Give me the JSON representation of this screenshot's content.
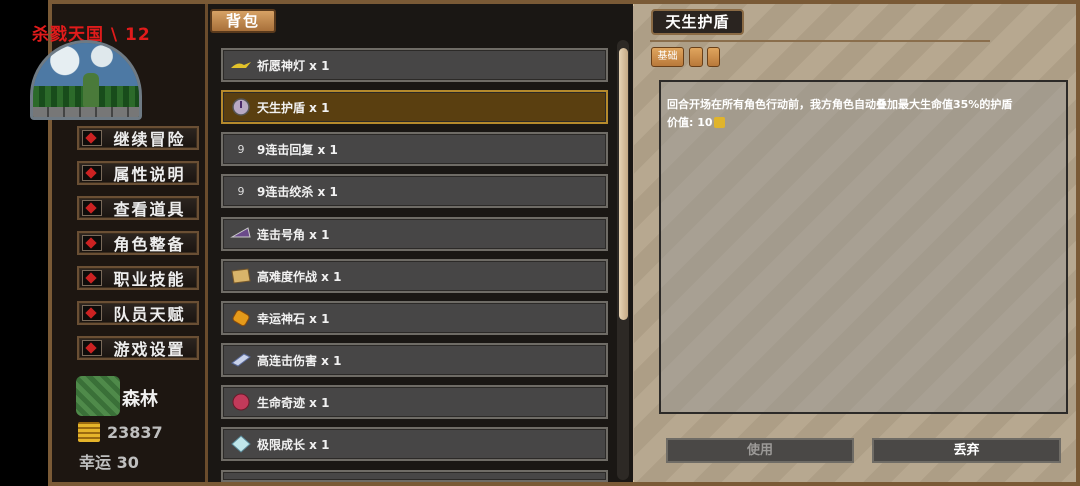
{
  "sidebar": {
    "game_title": "杀戮天国 \\ 12",
    "menu": [
      {
        "label": "继续冒险"
      },
      {
        "label": "属性说明"
      },
      {
        "label": "查看道具"
      },
      {
        "label": "角色整备"
      },
      {
        "label": "职业技能"
      },
      {
        "label": "队员天赋"
      },
      {
        "label": "游戏设置"
      }
    ],
    "region": "森林",
    "gold": "23837",
    "luck": "幸运 30"
  },
  "inventory": {
    "tab_label": "背包",
    "items": [
      {
        "name": "祈愿神灯 x 1",
        "icon": "lamp-icon",
        "selected": false
      },
      {
        "name": "天生护盾 x 1",
        "icon": "shield-orb-icon",
        "selected": true
      },
      {
        "name": "9连击回复 x 1",
        "icon_text": "9",
        "selected": false
      },
      {
        "name": "9连击绞杀 x 1",
        "icon_text": "9",
        "selected": false
      },
      {
        "name": "连击号角 x 1",
        "icon": "horn-icon",
        "selected": false
      },
      {
        "name": "高难度作战 x 1",
        "icon": "scroll-map-icon",
        "selected": false
      },
      {
        "name": "幸运神石 x 1",
        "icon": "lucky-stone-icon",
        "selected": false
      },
      {
        "name": "高连击伤害 x 1",
        "icon": "crystal-shard-icon",
        "selected": false
      },
      {
        "name": "生命奇迹 x 1",
        "icon": "life-orb-icon",
        "selected": false
      },
      {
        "name": "极限成长 x 1",
        "icon": "diamond-icon",
        "selected": false
      }
    ]
  },
  "detail": {
    "title": "天生护盾",
    "tag": "基础",
    "description": "回合开场在所有角色行动前，我方角色自动叠加最大生命值35%的护盾",
    "value_label": "价值: 10",
    "use_label": "使用",
    "discard_label": "丢弃"
  },
  "colors": {
    "title_red": "#e11b1b",
    "selected_item": "#5a3f10",
    "tab_orange": "#d7a265"
  }
}
